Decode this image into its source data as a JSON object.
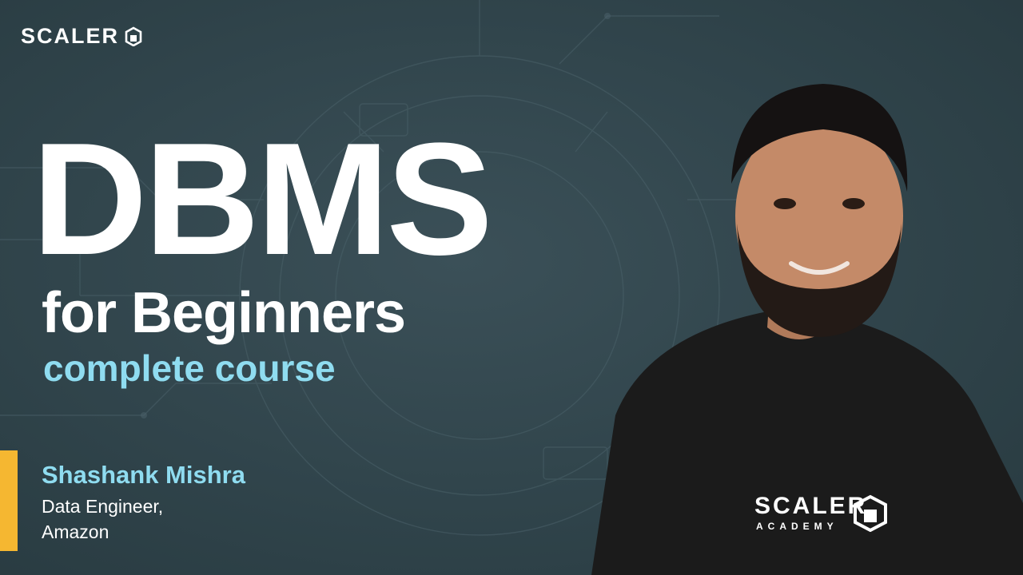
{
  "brand": {
    "name": "SCALER",
    "icon": "scaler-cube-icon"
  },
  "title": {
    "main": "DBMS",
    "sub": "for Beginners",
    "tag": "complete course"
  },
  "presenter": {
    "name": "Shashank Mishra",
    "role_line1": "Data Engineer,",
    "role_line2": "Amazon"
  },
  "shirt": {
    "word": "SCALER",
    "sub": "ACADEMY",
    "icon": "scaler-cube-icon"
  },
  "colors": {
    "background": "#30444b",
    "accent": "#f5b731",
    "highlight": "#8fdcf0",
    "text": "#ffffff",
    "shirt": "#1b1b1b"
  }
}
